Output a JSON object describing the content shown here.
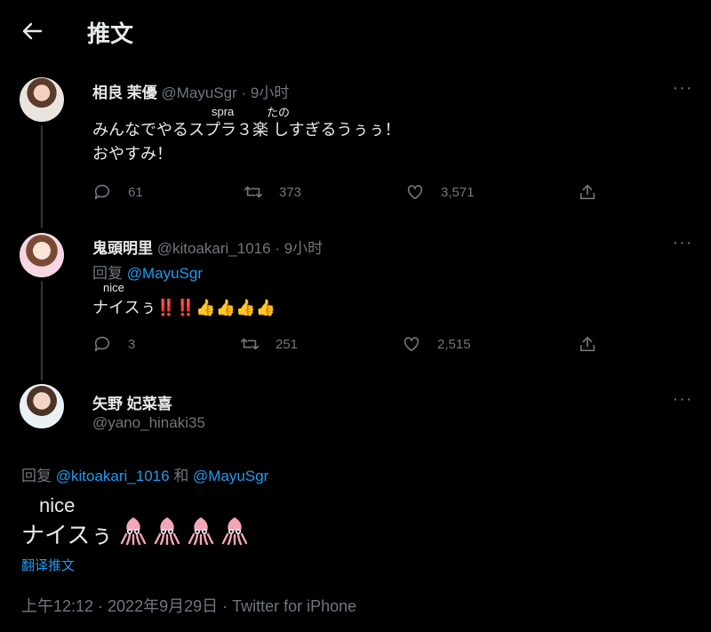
{
  "header": {
    "title": "推文",
    "back_icon": "arrow-left-icon"
  },
  "tweets": [
    {
      "name": "相良 茉優",
      "handle": "@MayuSgr",
      "dot": "·",
      "time": "9小时",
      "ruby_1": "spra",
      "ruby_2": "たの",
      "text_line1": "みんなでやるスプラ３楽 しすぎるうぅぅ！",
      "text_line2": "おやすみ！",
      "replies": "61",
      "retweets": "373",
      "likes": "3,571"
    },
    {
      "name": "鬼頭明里",
      "handle": "@kitoakari_1016",
      "dot": "·",
      "time": "9小时",
      "reply_label": "回复",
      "reply_mention": "@MayuSgr",
      "ruby": "nice",
      "text": "ナイスぅ‼️‼️👍👍👍👍",
      "replies": "3",
      "retweets": "251",
      "likes": "2,515"
    }
  ],
  "main_tweet": {
    "name": "矢野 妃菜喜",
    "handle": "@yano_hinaki35",
    "reply_label": "回复",
    "mention_1": "@kitoakari_1016",
    "and_label": "和",
    "mention_2": "@MayuSgr",
    "ruby": "nice",
    "text": "ナイスぅ",
    "squid_count": 4,
    "translate_label": "翻译推文",
    "timestamp": "上午12:12 · 2022年9月29日 · Twitter for iPhone"
  },
  "colors": {
    "background": "#000000",
    "text": "#e7e9ea",
    "muted": "#71767b",
    "link": "#1d9bf0",
    "squid": "#f3a6b7"
  }
}
